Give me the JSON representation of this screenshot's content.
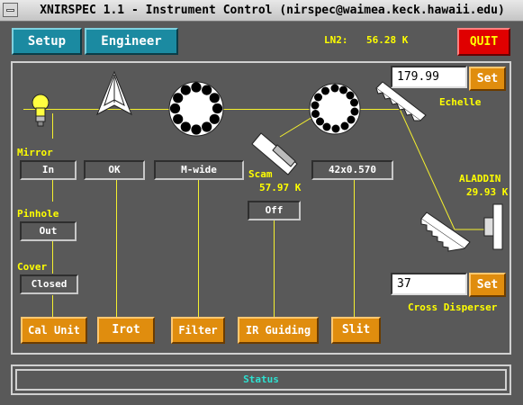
{
  "window": {
    "title": "XNIRSPEC 1.1 - Instrument Control  (nirspec@waimea.keck.hawaii.edu)"
  },
  "toolbar": {
    "setup_label": "Setup",
    "engineer_label": "Engineer",
    "quit_label": "QUIT"
  },
  "ln2": {
    "label": "LN2:",
    "value": "56.28 K"
  },
  "echelle": {
    "value": "179.99",
    "set_label": "Set",
    "label": "Echelle"
  },
  "cross_disperser": {
    "value": "37",
    "set_label": "Set",
    "label": "Cross Disperser"
  },
  "aladdin": {
    "label": "ALADDIN",
    "temp": "29.93 K"
  },
  "scam": {
    "label": "Scam",
    "temp": "57.97 K"
  },
  "mirror": {
    "label": "Mirror",
    "value": "In"
  },
  "pinhole": {
    "label": "Pinhole",
    "value": "Out"
  },
  "cover": {
    "label": "Cover",
    "value": "Closed"
  },
  "irot": {
    "value": "OK"
  },
  "filter": {
    "value": "M-wide"
  },
  "ir_guiding": {
    "value": "Off"
  },
  "slit": {
    "value": "42x0.570"
  },
  "buttons": {
    "cal_unit": "Cal Unit",
    "irot": "Irot",
    "filter": "Filter",
    "ir_guiding": "IR Guiding",
    "slit": "Slit"
  },
  "status": {
    "label": "Status"
  },
  "colors": {
    "background": "#595959",
    "accent_cyan": "#1b8aa1",
    "button_orange": "#e08d0e",
    "quit_red": "#e00000",
    "line_yellow": "#f5f02e"
  },
  "icons": [
    "window-menu-icon",
    "lamp-icon",
    "prism-icon",
    "filter-wheel-icon",
    "slit-wheel-icon",
    "scam-mirror-icon",
    "echelle-grating-icon",
    "cross-disperser-grating-icon",
    "detector-icon"
  ]
}
